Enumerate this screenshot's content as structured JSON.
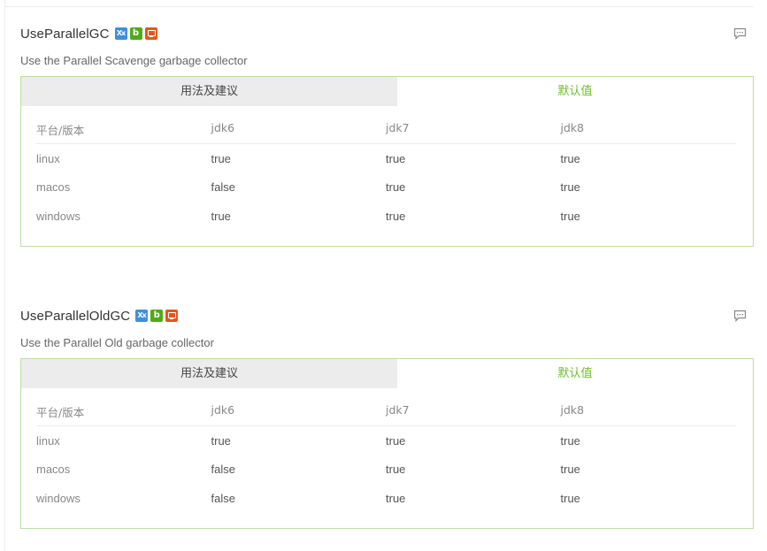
{
  "flags": [
    {
      "name": "UseParallelGC",
      "badges": [
        {
          "icon": "xx-type-icon",
          "text": "Xx",
          "color": "#3f8fe0"
        },
        {
          "icon": "boolean-icon",
          "text": "b",
          "color": "#52a91a"
        },
        {
          "icon": "monitor-icon",
          "text": "",
          "color": "#e5561c"
        }
      ],
      "description": "Use the Parallel Scavenge garbage collector",
      "tabs": {
        "usage": "用法及建议",
        "defaults": "默认值",
        "active": "defaults"
      },
      "table": {
        "headers": [
          "平台/版本",
          "jdk6",
          "jdk7",
          "jdk8"
        ],
        "rows": [
          [
            "linux",
            "true",
            "true",
            "true"
          ],
          [
            "macos",
            "false",
            "true",
            "true"
          ],
          [
            "windows",
            "true",
            "true",
            "true"
          ]
        ]
      }
    },
    {
      "name": "UseParallelOldGC",
      "badges": [
        {
          "icon": "xx-type-icon",
          "text": "Xx",
          "color": "#3f8fe0"
        },
        {
          "icon": "boolean-icon",
          "text": "b",
          "color": "#52a91a"
        },
        {
          "icon": "monitor-icon",
          "text": "",
          "color": "#e5561c"
        }
      ],
      "description": "Use the Parallel Old garbage collector",
      "tabs": {
        "usage": "用法及建议",
        "defaults": "默认值",
        "active": "defaults"
      },
      "table": {
        "headers": [
          "平台/版本",
          "jdk6",
          "jdk7",
          "jdk8"
        ],
        "rows": [
          [
            "linux",
            "true",
            "true",
            "true"
          ],
          [
            "macos",
            "false",
            "true",
            "true"
          ],
          [
            "windows",
            "false",
            "true",
            "true"
          ]
        ]
      }
    }
  ],
  "colors": {
    "accent_green": "#6bbf2a",
    "panel_border": "#b9e0a2",
    "tab_inactive_bg": "#ececec"
  }
}
